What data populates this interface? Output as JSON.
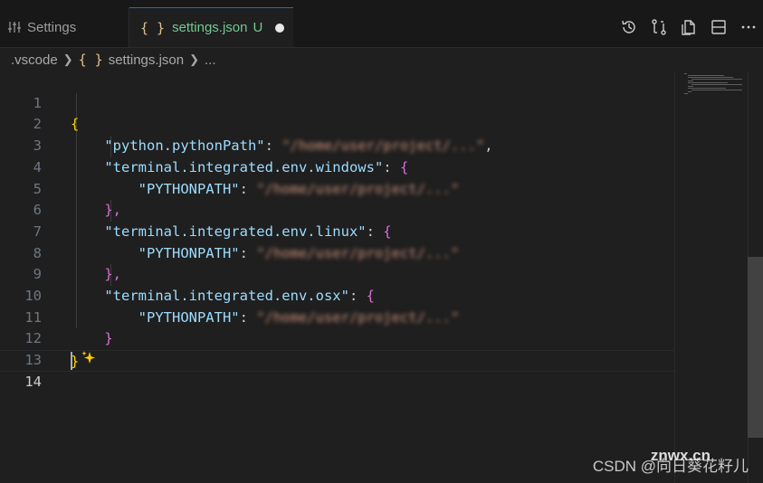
{
  "tabs": [
    {
      "label": "Settings",
      "icon": "settings-sliders-icon"
    },
    {
      "label": "settings.json",
      "status": "U",
      "icon": "json-braces-icon",
      "dirty": true
    }
  ],
  "editor_actions": [
    "timeline-icon",
    "compare-changes-icon",
    "open-settings-icon",
    "split-editor-icon",
    "more-actions-icon"
  ],
  "breadcrumb": {
    "folder": ".vscode",
    "brace": "{ }",
    "file": "settings.json",
    "more": "..."
  },
  "lines": [
    {
      "num": "1"
    },
    {
      "num": "2"
    },
    {
      "num": "3"
    },
    {
      "num": "4"
    },
    {
      "num": "5"
    },
    {
      "num": "6"
    },
    {
      "num": "7"
    },
    {
      "num": "8"
    },
    {
      "num": "9"
    },
    {
      "num": "10"
    },
    {
      "num": "11"
    },
    {
      "num": "12"
    },
    {
      "num": "13"
    },
    {
      "num": "14"
    }
  ],
  "code": {
    "open_brace": "{",
    "close_brace": "}",
    "python_path_key": "\"python.pythonPath\"",
    "python_path_value": "\"/home/user/project/...\"",
    "windows_key": "\"terminal.integrated.env.windows\"",
    "linux_key": "\"terminal.integrated.env.linux\"",
    "osx_key": "\"terminal.integrated.env.osx\"",
    "pythonpath_key": "\"PYTHONPATH\"",
    "pythonpath_value_win": "\"/home/user/project/...\"",
    "pythonpath_value_linux": "\"/home/user/project/...\"",
    "pythonpath_value_osx": "\"/home/user/project/...\"",
    "colon": ": ",
    "comma": ",",
    "inner_open": "{",
    "inner_close": "}",
    "inner_close_comma": "},"
  },
  "watermark": {
    "csdn": "CSDN @向日葵花籽儿",
    "site": "znwx.cn"
  },
  "colors": {
    "key": "#9cdcfe",
    "string": "#ce9178",
    "brace_l1": "#ffd700",
    "brace_l2": "#da70d6",
    "accent": "#0078d4",
    "untracked": "#73c991"
  }
}
